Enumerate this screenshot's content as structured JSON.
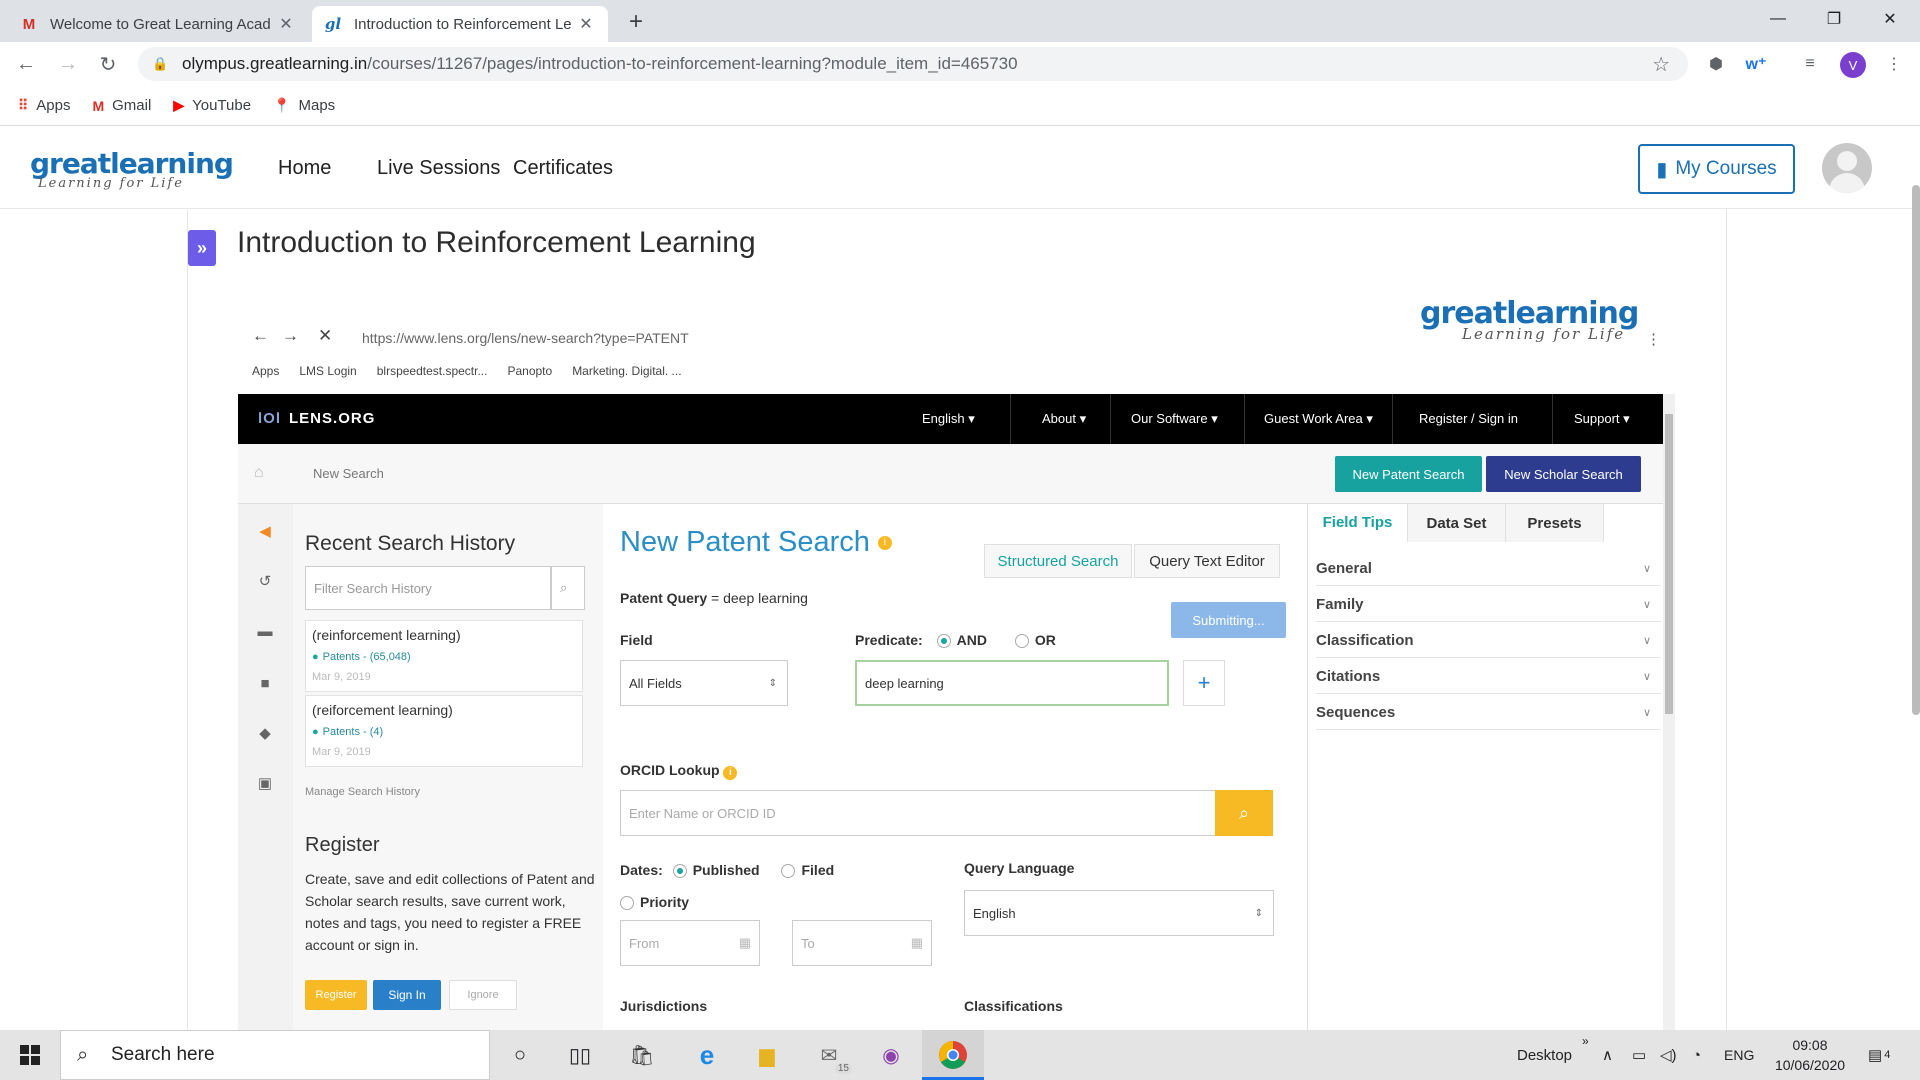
{
  "browser": {
    "tabs": [
      {
        "title": "Welcome to Great Learning Acad",
        "icon": "gmail-icon"
      },
      {
        "title": "Introduction to Reinforcement Le",
        "icon": "greatlearning-icon"
      }
    ],
    "new_tab": "+",
    "url_host": "olympus.greatlearning.in",
    "url_path": "/courses/11267/pages/introduction-to-reinforcement-learning?module_item_id=465730",
    "profile_initial": "V",
    "bookmarks": [
      {
        "label": "Apps",
        "icon": "apps-grid-icon"
      },
      {
        "label": "Gmail",
        "icon": "gmail-icon"
      },
      {
        "label": "YouTube",
        "icon": "youtube-icon"
      },
      {
        "label": "Maps",
        "icon": "maps-pin-icon"
      }
    ]
  },
  "site": {
    "logo_word": "greatlearning",
    "logo_tag": "Learning for Life",
    "nav": [
      "Home",
      "Live Sessions",
      "Certificates"
    ],
    "my_courses": "My Courses",
    "sidebar_toggle": "»",
    "page_title": "Introduction to Reinforcement Learning"
  },
  "embed": {
    "url": "https://www.lens.org/lens/new-search?type=PATENT",
    "logo_word": "greatlearning",
    "logo_tag": "Learning for Life",
    "bookmarks": [
      "Apps",
      "LMS Login",
      "blrspeedtest.spectr...",
      "Panopto",
      "Marketing. Digital. ..."
    ],
    "lens": {
      "brand": "LENS.ORG",
      "menu": [
        "English ▾",
        "About ▾",
        "Our Software ▾",
        "Guest Work Area ▾",
        "Register  /  Sign in",
        "Support ▾"
      ],
      "breadcrumb": "New Search",
      "new_patent_btn": "New Patent Search",
      "new_scholar_btn": "New Scholar Search"
    },
    "history": {
      "title": "Recent Search History",
      "filter_placeholder": "Filter Search History",
      "items": [
        {
          "query": "(reinforcement learning)",
          "patents": "Patents - (65,048)",
          "date": "Mar 9, 2019"
        },
        {
          "query": "(reiforcement learning)",
          "patents": "Patents - (4)",
          "date": "Mar 9, 2019"
        }
      ],
      "manage": "Manage Search History",
      "register_title": "Register",
      "register_text": "Create, save and edit collections of Patent and Scholar search results, save current work, notes and tags, you need to register a FREE account or sign in.",
      "btn_register": "Register",
      "btn_signin": "Sign In",
      "btn_ignore": "Ignore"
    },
    "search": {
      "title": "New Patent Search",
      "tab_structured": "Structured Search",
      "tab_query": "Query Text Editor",
      "patent_query_label": "Patent Query",
      "patent_query_eq": "=",
      "patent_query_value": "deep learning",
      "submitting": "Submitting...",
      "field_label": "Field",
      "field_value": "All Fields",
      "predicate_label": "Predicate:",
      "predicate_and": "AND",
      "predicate_or": "OR",
      "term_value": "deep learning",
      "add_btn": "+",
      "orcid_label": "ORCID Lookup",
      "orcid_placeholder": "Enter Name or ORCID ID",
      "dates_label": "Dates:",
      "date_published": "Published",
      "date_filed": "Filed",
      "date_priority": "Priority",
      "from_placeholder": "From",
      "to_placeholder": "To",
      "query_language_label": "Query Language",
      "query_language_value": "English",
      "jurisdictions_label": "Jurisdictions",
      "classifications_label": "Classifications"
    },
    "right": {
      "tabs": [
        "Field Tips",
        "Data Set",
        "Presets"
      ],
      "accordions": [
        "General",
        "Family",
        "Classification",
        "Citations",
        "Sequences"
      ]
    }
  },
  "taskbar": {
    "search_placeholder": "Search here",
    "mail_badge": "15",
    "desktop_label": "Desktop",
    "language": "ENG",
    "time": "09:08",
    "date": "10/06/2020",
    "notif_count": "4"
  },
  "colors": {
    "brand_blue": "#1a6fb5",
    "lens_teal": "#17a2a0",
    "lens_navy": "#2d3c8e",
    "submit_blue": "#8bb8e8",
    "gold": "#f7b924",
    "sidebar_toggle": "#6c5ce7"
  }
}
